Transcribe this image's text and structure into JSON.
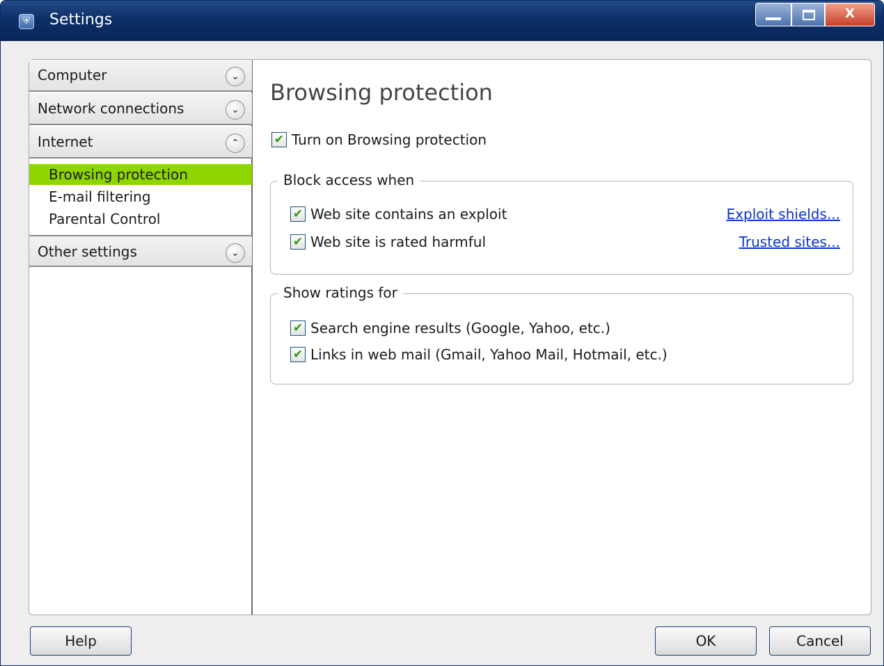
{
  "window": {
    "title": "Settings",
    "minimize_icon": "minimize-icon",
    "maximize_icon": "maximize-icon",
    "close_icon": "close-icon",
    "close_glyph": "X"
  },
  "sidebar": {
    "sections": [
      {
        "label": "Computer",
        "expanded": false,
        "icon": "chevron-down-icon",
        "glyph": "⌄"
      },
      {
        "label": "Network connections",
        "expanded": false,
        "icon": "chevron-down-icon",
        "glyph": "⌄"
      },
      {
        "label": "Internet",
        "expanded": true,
        "icon": "chevron-up-icon",
        "glyph": "⌃"
      },
      {
        "label": "Other settings",
        "expanded": false,
        "icon": "chevron-down-icon",
        "glyph": "⌄"
      }
    ],
    "internet_items": [
      {
        "label": "Browsing protection",
        "selected": true
      },
      {
        "label": "E-mail filtering",
        "selected": false
      },
      {
        "label": "Parental Control",
        "selected": false
      }
    ],
    "selected_color": "#8ed600"
  },
  "content": {
    "title": "Browsing protection",
    "turn_on": {
      "label": "Turn on Browsing protection",
      "checked": true
    },
    "block_group": {
      "title": "Block access when",
      "options": [
        {
          "label": "Web site contains an exploit",
          "checked": true,
          "link": "Exploit shields..."
        },
        {
          "label": "Web site is rated harmful",
          "checked": true,
          "link": "Trusted sites..."
        }
      ]
    },
    "ratings_group": {
      "title": "Show ratings for",
      "options": [
        {
          "label": "Search engine results (Google, Yahoo, etc.)",
          "checked": true
        },
        {
          "label": "Links in web mail (Gmail, Yahoo Mail, Hotmail, etc.)",
          "checked": true
        }
      ]
    },
    "check_glyph": "✔",
    "link_color": "#0a33c8"
  },
  "footer": {
    "help_label": "Help",
    "ok_label": "OK",
    "cancel_label": "Cancel"
  }
}
